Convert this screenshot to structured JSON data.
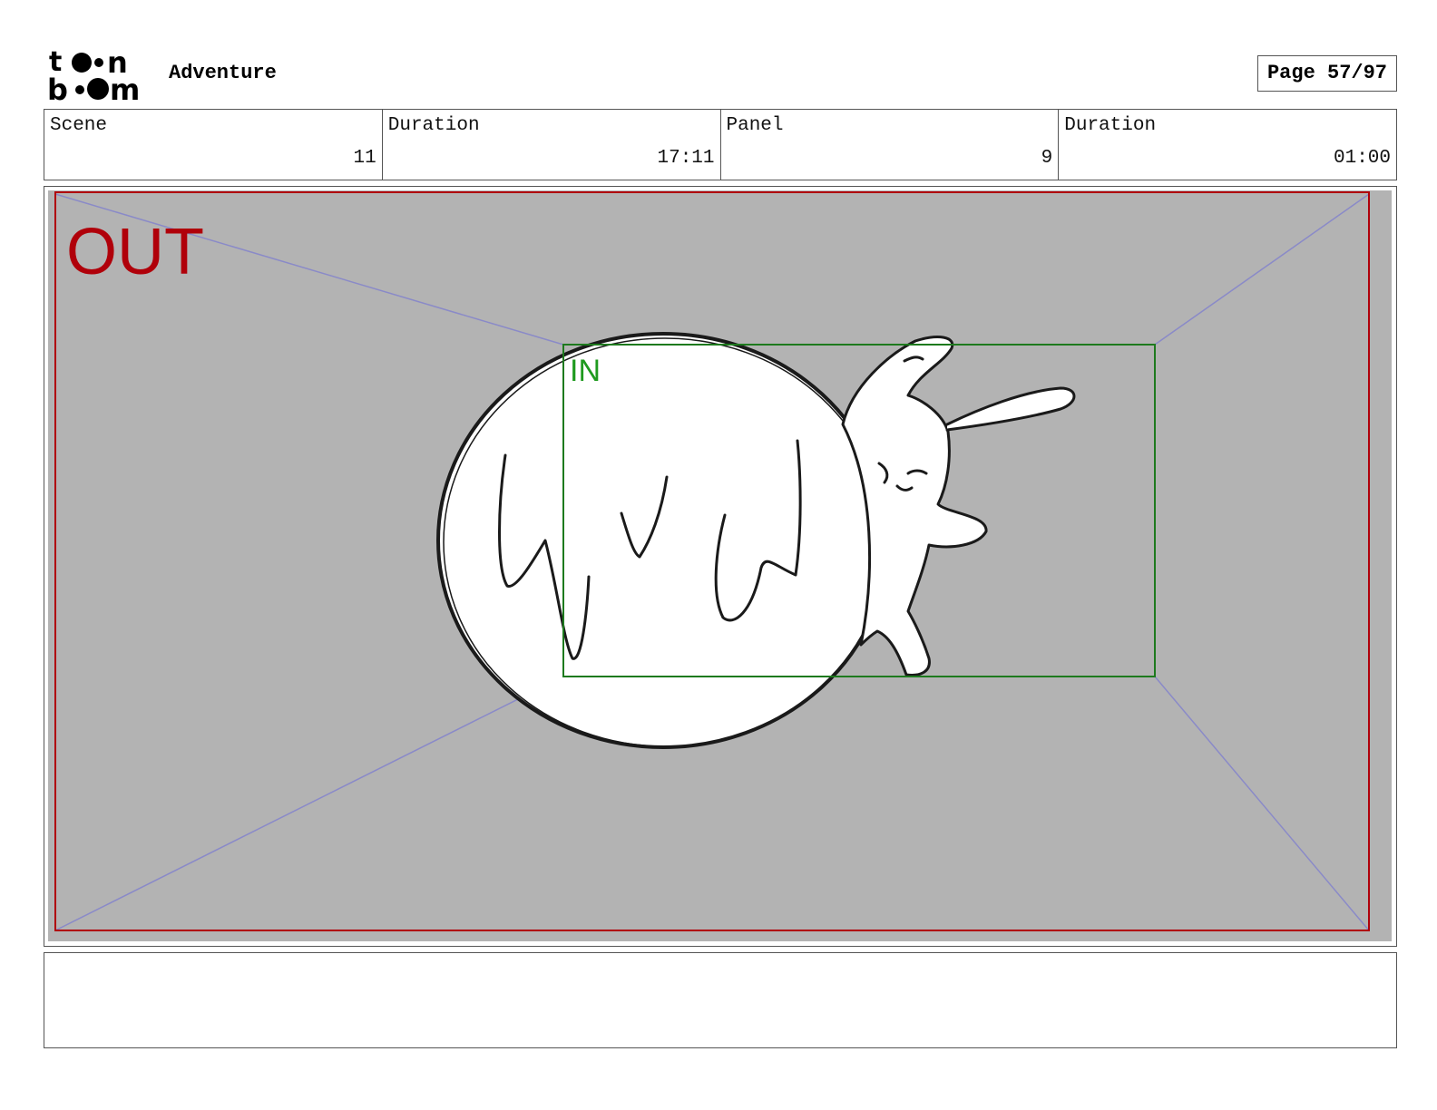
{
  "header": {
    "logo_text_top": "toon",
    "logo_text_bottom": "boom",
    "project_title": "Adventure",
    "page_label": "Page 57/97"
  },
  "info": [
    {
      "label": "Scene",
      "value": "11"
    },
    {
      "label": "Duration",
      "value": "17:11"
    },
    {
      "label": "Panel",
      "value": "9"
    },
    {
      "label": "Duration",
      "value": "01:00"
    }
  ],
  "panel": {
    "out_label": "OUT",
    "in_label": "IN",
    "colors": {
      "background": "#b3b3b3",
      "out_frame": "#b0000a",
      "in_frame": "#1e7a1e",
      "guides": "#8a8ac8",
      "sketch": "#1a1a1a"
    }
  },
  "notes": {
    "text": ""
  }
}
